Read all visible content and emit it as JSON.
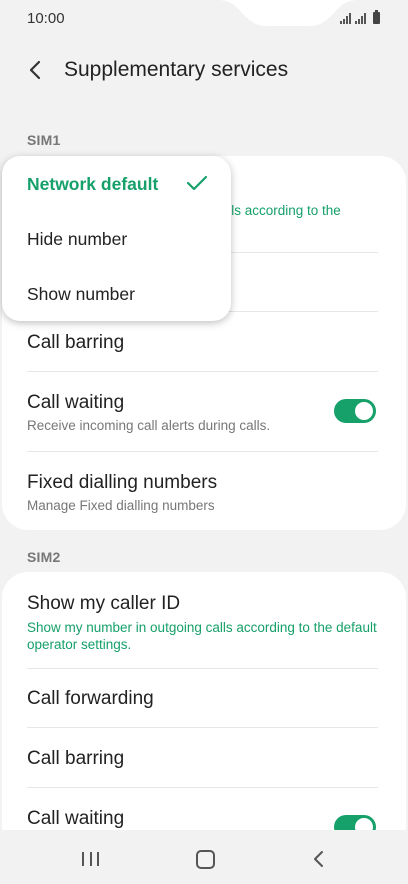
{
  "status": {
    "time": "10:00"
  },
  "header": {
    "title": "Supplementary services"
  },
  "sim1": {
    "label": "SIM1",
    "caller_id_sub_fragment": "calls according to the",
    "items": [
      {
        "title": "Call barring"
      },
      {
        "title": "Call waiting",
        "sub": "Receive incoming call alerts during calls.",
        "toggle": true
      },
      {
        "title": "Fixed dialling numbers",
        "sub": "Manage Fixed dialling numbers"
      }
    ]
  },
  "popup": {
    "options": [
      "Network default",
      "Hide number",
      "Show number"
    ],
    "selected": "Network default"
  },
  "sim2": {
    "label": "SIM2",
    "items": [
      {
        "title": "Show my caller ID",
        "sub": "Show my number in outgoing calls according to the default operator settings."
      },
      {
        "title": "Call forwarding"
      },
      {
        "title": "Call barring"
      },
      {
        "title": "Call waiting",
        "toggle": true
      }
    ]
  },
  "colors": {
    "accent": "#16a06a",
    "background": "#f2f2f2",
    "card": "#ffffff"
  }
}
